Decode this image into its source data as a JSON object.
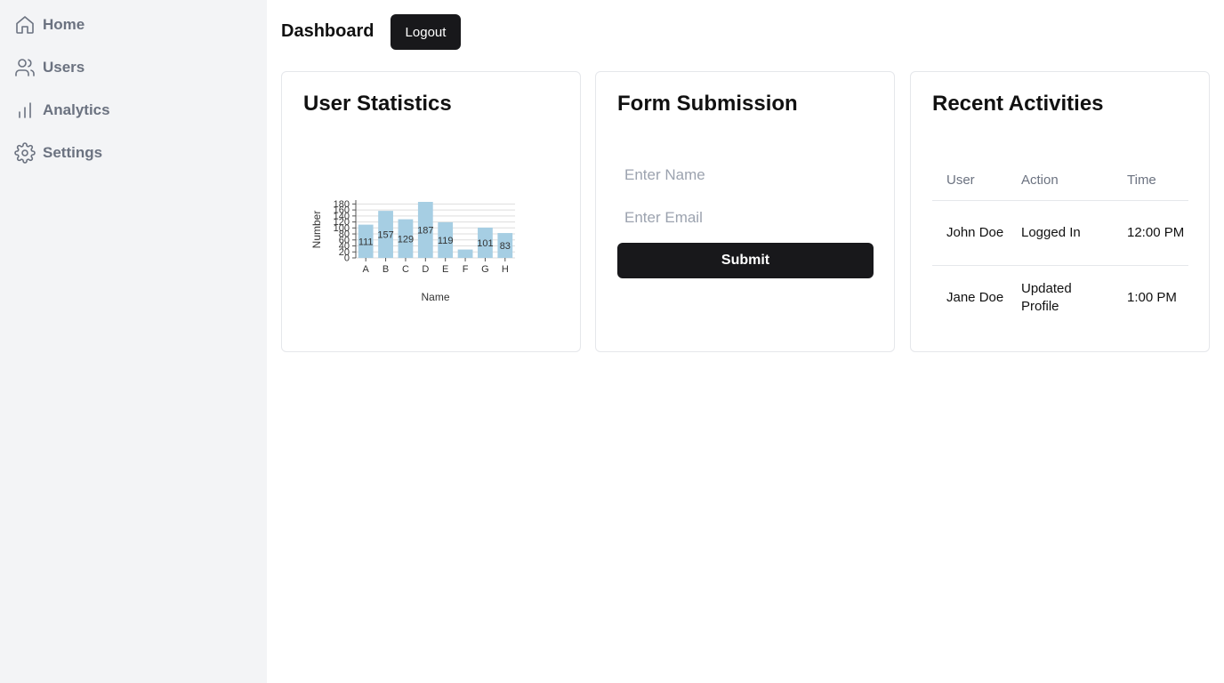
{
  "sidebar": {
    "items": [
      {
        "label": "Home",
        "icon": "home-icon"
      },
      {
        "label": "Users",
        "icon": "users-icon"
      },
      {
        "label": "Analytics",
        "icon": "bar-chart-icon"
      },
      {
        "label": "Settings",
        "icon": "gear-icon"
      }
    ]
  },
  "header": {
    "title": "Dashboard",
    "logout_label": "Logout"
  },
  "stats_card": {
    "title": "User Statistics"
  },
  "chart_data": {
    "type": "bar",
    "categories": [
      "A",
      "B",
      "C",
      "D",
      "E",
      "F",
      "G",
      "H"
    ],
    "values": [
      111,
      157,
      129,
      187,
      119,
      28,
      101,
      83
    ],
    "data_labels": [
      "111",
      "157",
      "129",
      "187",
      "119",
      "",
      "101",
      "83"
    ],
    "xlabel": "Name",
    "ylabel": "Number",
    "yticks": [
      0,
      20,
      40,
      60,
      80,
      100,
      120,
      140,
      160,
      180
    ],
    "ylim": [
      0,
      187
    ],
    "grid": true,
    "bar_color": "#a6cee3"
  },
  "form_card": {
    "title": "Form Submission",
    "name_placeholder": "Enter Name",
    "email_placeholder": "Enter Email",
    "submit_label": "Submit"
  },
  "activity_card": {
    "title": "Recent Activities",
    "columns": [
      "User",
      "Action",
      "Time"
    ],
    "rows": [
      [
        "John Doe",
        "Logged In",
        "12:00 PM"
      ],
      [
        "Jane Doe",
        "Updated Profile",
        "1:00 PM"
      ]
    ]
  },
  "colors": {
    "sidebar_bg": "#f3f4f6",
    "button_bg": "#18181b",
    "muted_text": "#6b7280"
  }
}
